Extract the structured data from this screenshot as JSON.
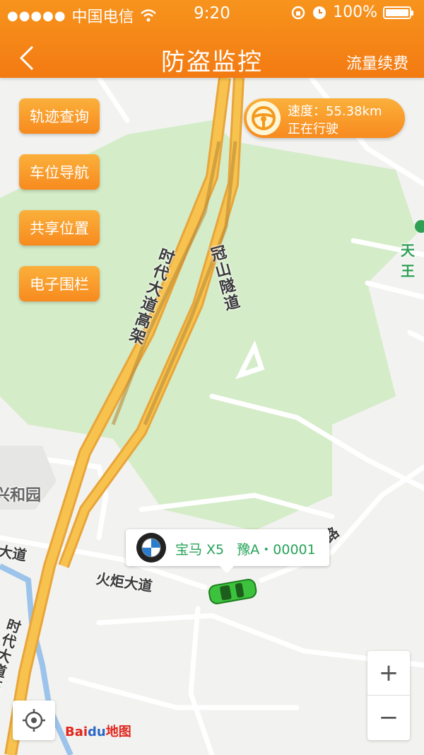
{
  "status_bar": {
    "carrier": "中国电信",
    "time": "9:20",
    "battery": "100%"
  },
  "nav": {
    "title": "防盗监控",
    "right_action": "流量续费"
  },
  "side_buttons": [
    {
      "label": "轨迹查询"
    },
    {
      "label": "车位导航"
    },
    {
      "label": "共享位置"
    },
    {
      "label": "电子围栏"
    }
  ],
  "speed_panel": {
    "speed_text": "速度：55.38km",
    "state_text": "正在行驶"
  },
  "vehicle": {
    "brand_model": "宝马 X5",
    "plate": "豫A・00001"
  },
  "map": {
    "road_labels": {
      "elevated_top": "时代大道高架",
      "tunnel": "冠山隧道",
      "huoju": "火炬大道",
      "dadao_left": "大道",
      "elevated_bottom": "时代大道高架",
      "area_left": "兴和园",
      "poi_right": "天王",
      "road_right": "路"
    },
    "zoom_in": "+",
    "zoom_out": "−",
    "logo_bai": "Bai",
    "logo_du": "du",
    "logo_map": "地图"
  },
  "colors": {
    "accent": "#f7941d",
    "green_area": "#d4ecc8",
    "highway": "#f7c24d"
  }
}
